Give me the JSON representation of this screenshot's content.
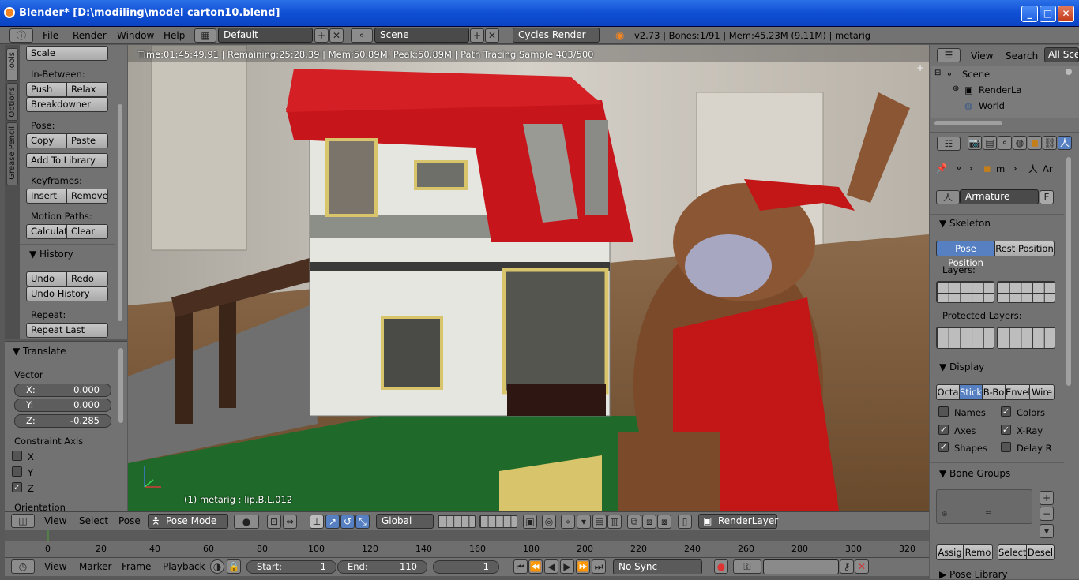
{
  "window": {
    "title": "Blender* [D:\\modiling\\model carton10.blend]"
  },
  "topbar": {
    "menus": [
      "File",
      "Render",
      "Window",
      "Help"
    ],
    "layout": "Default",
    "scene": "Scene",
    "engine": "Cycles Render",
    "stats": "v2.73 | Bones:1/91 | Mem:45.23M (9.11M) | metarig"
  },
  "tool_tabs": [
    "Tools",
    "Options",
    "Grease Pencil"
  ],
  "tools": {
    "scale": "Scale",
    "in_between": "In-Between:",
    "push": "Push",
    "relax": "Relax",
    "breakdowner": "Breakdowner",
    "pose": "Pose:",
    "copy": "Copy",
    "paste": "Paste",
    "add_to_library": "Add To Library",
    "keyframes": "Keyframes:",
    "insert": "Insert",
    "remove": "Remove",
    "motion_paths": "Motion Paths:",
    "calculate": "Calculat",
    "clear": "Clear",
    "history": "History",
    "undo": "Undo",
    "redo": "Redo",
    "undo_history": "Undo History",
    "repeat": "Repeat:",
    "repeat_last": "Repeat Last"
  },
  "operator": {
    "title": "Translate",
    "vector": "Vector",
    "x_label": "X:",
    "x": "0.000",
    "y_label": "Y:",
    "y": "0.000",
    "z_label": "Z:",
    "z": "-0.285",
    "constraint_axis": "Constraint Axis",
    "cx": "X",
    "cy": "Y",
    "cz": "Z",
    "orientation": "Orientation"
  },
  "viewport": {
    "render_status": "Time:01:45:49.91 | Remaining:25:28.39 | Mem:50.89M, Peak:50.89M | Path Tracing Sample 403/500",
    "object_info": "(1) metarig : lip.B.L.012"
  },
  "header3d": {
    "menus": [
      "View",
      "Select",
      "Pose"
    ],
    "mode": "Pose Mode",
    "orientation": "Global",
    "render_layer": "RenderLayer"
  },
  "timeline": {
    "ticks": [
      "0",
      "20",
      "40",
      "60",
      "80",
      "100",
      "120",
      "140",
      "160",
      "180",
      "200",
      "220",
      "240",
      "260",
      "280",
      "300",
      "320"
    ],
    "menus": [
      "View",
      "Marker",
      "Frame",
      "Playback"
    ],
    "start_label": "Start:",
    "start": "1",
    "end_label": "End:",
    "end": "110",
    "current": "1",
    "sync": "No Sync"
  },
  "outliner": {
    "menus": [
      "View",
      "Search"
    ],
    "filter": "All Sce",
    "items": [
      "Scene",
      "RenderLa",
      "World"
    ]
  },
  "properties": {
    "breadcrumb_obj": "m",
    "breadcrumb_arm": "Ar",
    "datablock": "Armature",
    "fake_user": "F",
    "skeleton": "Skeleton",
    "pose_position": "Pose Position",
    "rest_position": "Rest Position",
    "layers": "Layers:",
    "protected_layers": "Protected Layers:",
    "display": "Display",
    "display_modes": [
      "Octa",
      "Stick",
      "B-Bo",
      "Envel",
      "Wire"
    ],
    "names": "Names",
    "colors": "Colors",
    "axes": "Axes",
    "xray": "X-Ray",
    "shapes": "Shapes",
    "delay": "Delay R",
    "bone_groups": "Bone Groups",
    "assign": "Assig",
    "remove": "Remo",
    "select": "Select",
    "deselect": "Desel",
    "pose_library": "Pose Library"
  },
  "colors": {
    "accent": "#5680c2",
    "title_blue": "#0f4fd4"
  }
}
